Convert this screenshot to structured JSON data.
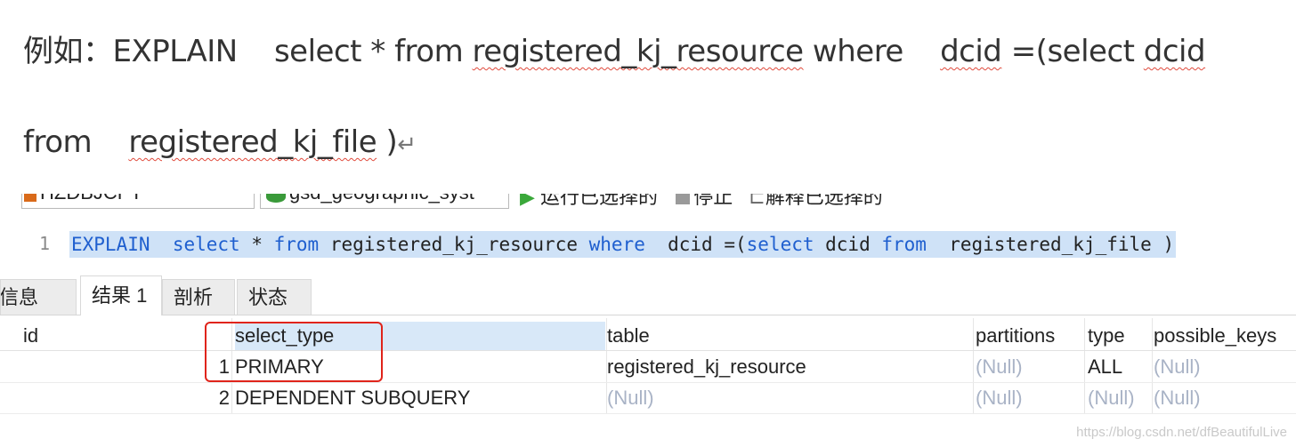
{
  "document": {
    "line1": {
      "prefix": "例如：EXPLAIN    select * from ",
      "table1": "registered_kj_resource",
      "mid": " where    ",
      "col1": "dcid",
      "mid2": " =(select ",
      "col2": "dcid"
    },
    "line2": {
      "prefix": "from    ",
      "table2": "registered_kj_file",
      "suffix": " )",
      "return_mark": "↵"
    }
  },
  "toolbar": {
    "connection": "HZDBJCPT",
    "database": "gsd_geographic_syst",
    "run_label": "运行已选择的",
    "stop_label": "停止",
    "explain_label": "解释已选择的"
  },
  "editor": {
    "line_number": "1",
    "tokens": {
      "t1": "EXPLAIN",
      "t2": "  ",
      "t3": "select",
      "t4": " * ",
      "t5": "from",
      "t6": " registered_kj_resource ",
      "t7": "where",
      "t8": "  dcid =(",
      "t9": "select",
      "t10": " dcid ",
      "t11": "from",
      "t12": "  registered_kj_file )"
    }
  },
  "tabs": [
    {
      "label": "信息"
    },
    {
      "label": "结果 1"
    },
    {
      "label": "剖析"
    },
    {
      "label": "状态"
    }
  ],
  "grid": {
    "columns": [
      "id",
      "select_type",
      "table",
      "partitions",
      "type",
      "possible_keys"
    ],
    "rows": [
      [
        "1",
        "PRIMARY",
        "registered_kj_resource",
        "(Null)",
        "ALL",
        "(Null)"
      ],
      [
        "2",
        "DEPENDENT SUBQUERY",
        "(Null)",
        "(Null)",
        "(Null)",
        "(Null)"
      ]
    ]
  },
  "watermark": "https://blog.csdn.net/dfBeautifulLive",
  "colors": {
    "keyword": "#1f5fcf",
    "selection": "#cfe2f7",
    "null_text": "#a9b3c6",
    "highlight_box": "#e0241b"
  }
}
